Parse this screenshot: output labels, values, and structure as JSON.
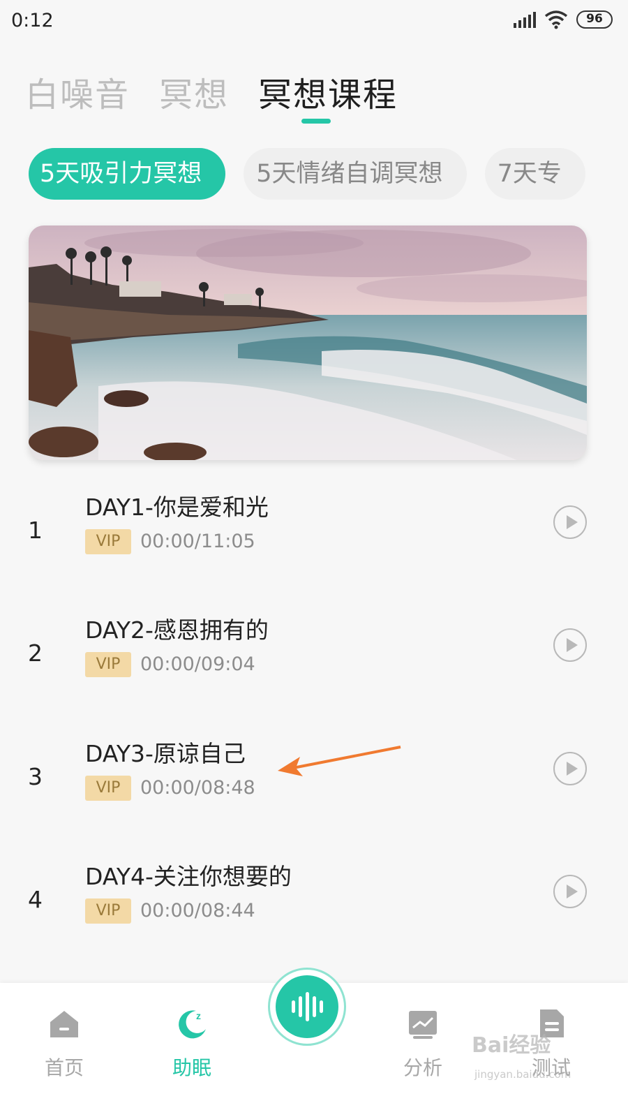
{
  "status_bar": {
    "time": "0:12",
    "battery": "96"
  },
  "top_tabs": [
    {
      "label": "白噪音"
    },
    {
      "label": "冥想"
    },
    {
      "label": "冥想课程"
    }
  ],
  "chips": [
    {
      "label": "5天吸引力冥想"
    },
    {
      "label": "5天情绪自调冥想"
    },
    {
      "label": "7天专"
    }
  ],
  "courses": [
    {
      "num": "1",
      "title": "DAY1-你是爱和光",
      "badge": "VIP",
      "time": "00:00/11:05"
    },
    {
      "num": "2",
      "title": "DAY2-感恩拥有的",
      "badge": "VIP",
      "time": "00:00/09:04"
    },
    {
      "num": "3",
      "title": "DAY3-原谅自己",
      "badge": "VIP",
      "time": "00:00/08:48"
    },
    {
      "num": "4",
      "title": "DAY4-关注你想要的",
      "badge": "VIP",
      "time": "00:00/08:44"
    }
  ],
  "bottom_nav": [
    {
      "label": "首页",
      "icon": "home-icon"
    },
    {
      "label": "助眠",
      "icon": "sleep-moon-icon"
    },
    {
      "label": "分析",
      "icon": "analysis-chart-icon"
    },
    {
      "label": "测试",
      "icon": "test-document-icon"
    }
  ],
  "center_button": {
    "icon": "sound-wave-icon"
  },
  "watermark": {
    "text": "Bai经验",
    "sub": "jingyan.baidu.com"
  },
  "colors": {
    "accent": "#25c6a7",
    "vip": "#f3d9a6",
    "arrow": "#f07a30"
  }
}
